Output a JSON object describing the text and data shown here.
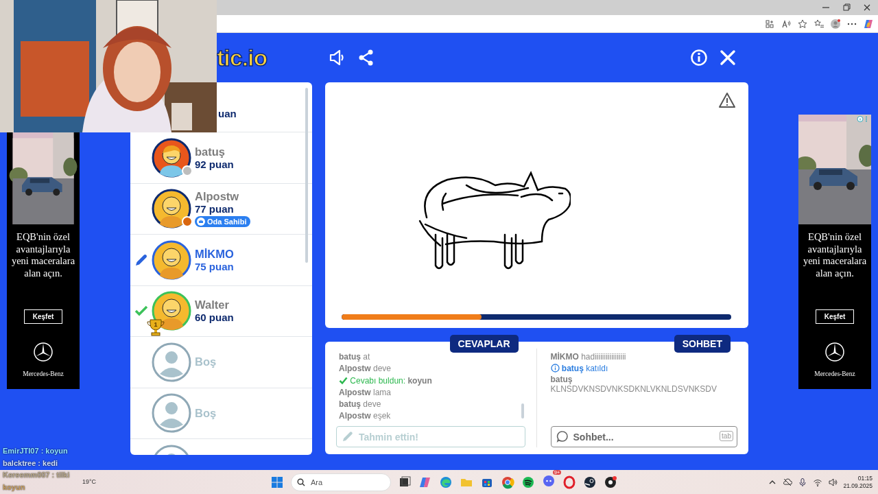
{
  "game": {
    "logo": "tic.io"
  },
  "players": [
    {
      "kind": "partial",
      "score": "uan"
    },
    {
      "kind": "player",
      "name": "batuş",
      "score": "92 puan",
      "avatar": {
        "kind": "boy"
      },
      "color": "#bdbdbd",
      "drawing": false,
      "guessed": false
    },
    {
      "kind": "player",
      "name": "Alpostw",
      "score": "77 puan",
      "avatar": {
        "kind": "bald"
      },
      "color": "#d9660f",
      "badge": "Oda Sahibi",
      "drawing": false,
      "guessed": false
    },
    {
      "kind": "player",
      "name": "MİKMO",
      "score": "75 puan",
      "avatar": {
        "kind": "bald"
      },
      "drawing": true,
      "guessed": false
    },
    {
      "kind": "player",
      "name": "Walter",
      "score": "60 puan",
      "avatar": {
        "kind": "bald"
      },
      "drawing": false,
      "guessed": true,
      "trophy": "1"
    },
    {
      "kind": "empty",
      "name": "Boş"
    },
    {
      "kind": "empty",
      "name": "Boş"
    },
    {
      "kind": "cut"
    }
  ],
  "canvas": {
    "progress": {
      "level": 0.36
    }
  },
  "answers": {
    "tab": "CEVAPLAR",
    "messages": [
      {
        "kind": "message",
        "user": "batuş",
        "text": "at"
      },
      {
        "kind": "message",
        "user": "Alpostw",
        "text": "deve"
      },
      {
        "kind": "correct",
        "text": "Cevabı buldun:",
        "answer": "koyun"
      },
      {
        "kind": "message",
        "user": "Alpostw",
        "text": "lama"
      },
      {
        "kind": "message",
        "user": "batuş",
        "text": "deve"
      },
      {
        "kind": "message",
        "user": "Alpostw",
        "text": "eşek"
      }
    ],
    "field": {
      "placeholder": "Tahmin ettin!",
      "disabled": true
    }
  },
  "chat": {
    "tab": "SOHBET",
    "messages": [
      {
        "kind": "message",
        "user": "MİKMO",
        "text": "hadiiiiiiiiiiiiiiiii"
      },
      {
        "kind": "join",
        "user": "batuş",
        "text": "katıldı"
      },
      {
        "kind": "block",
        "user": "batuş",
        "text": "KLNSDVKNSDVNKSDKNLVKNLDSVNKSDV"
      }
    ],
    "field": {
      "placeholder": "Sohbet...",
      "hint": "tab"
    }
  },
  "ads": [
    {
      "headline": "EQB'nin özel avantajlarıyla yeni maceralara alan açın.",
      "button": "Keşfet",
      "brand": "Mercedes-Benz",
      "ad_choices": false
    },
    {
      "headline": "EQB'nin özel avantajlarıyla yeni maceralara alan açın.",
      "button": "Keşfet",
      "brand": "Mercedes-Benz",
      "ad_choices": true
    }
  ],
  "stream_chat": [
    {
      "text": "EmirJTI07 : koyun",
      "color": "#8fe3ff"
    },
    {
      "text": "balcktree : kedi",
      "color": "#cfe0ff"
    },
    {
      "text": "Kereemm007 : tilki",
      "color": "#b9a98a"
    },
    {
      "text": "koyun",
      "color": "#c9a060"
    }
  ],
  "taskbar": {
    "search_placeholder": "Ara",
    "weather": "19°C",
    "badge": "9+",
    "time": "01:15",
    "date": "21.09.2025"
  }
}
